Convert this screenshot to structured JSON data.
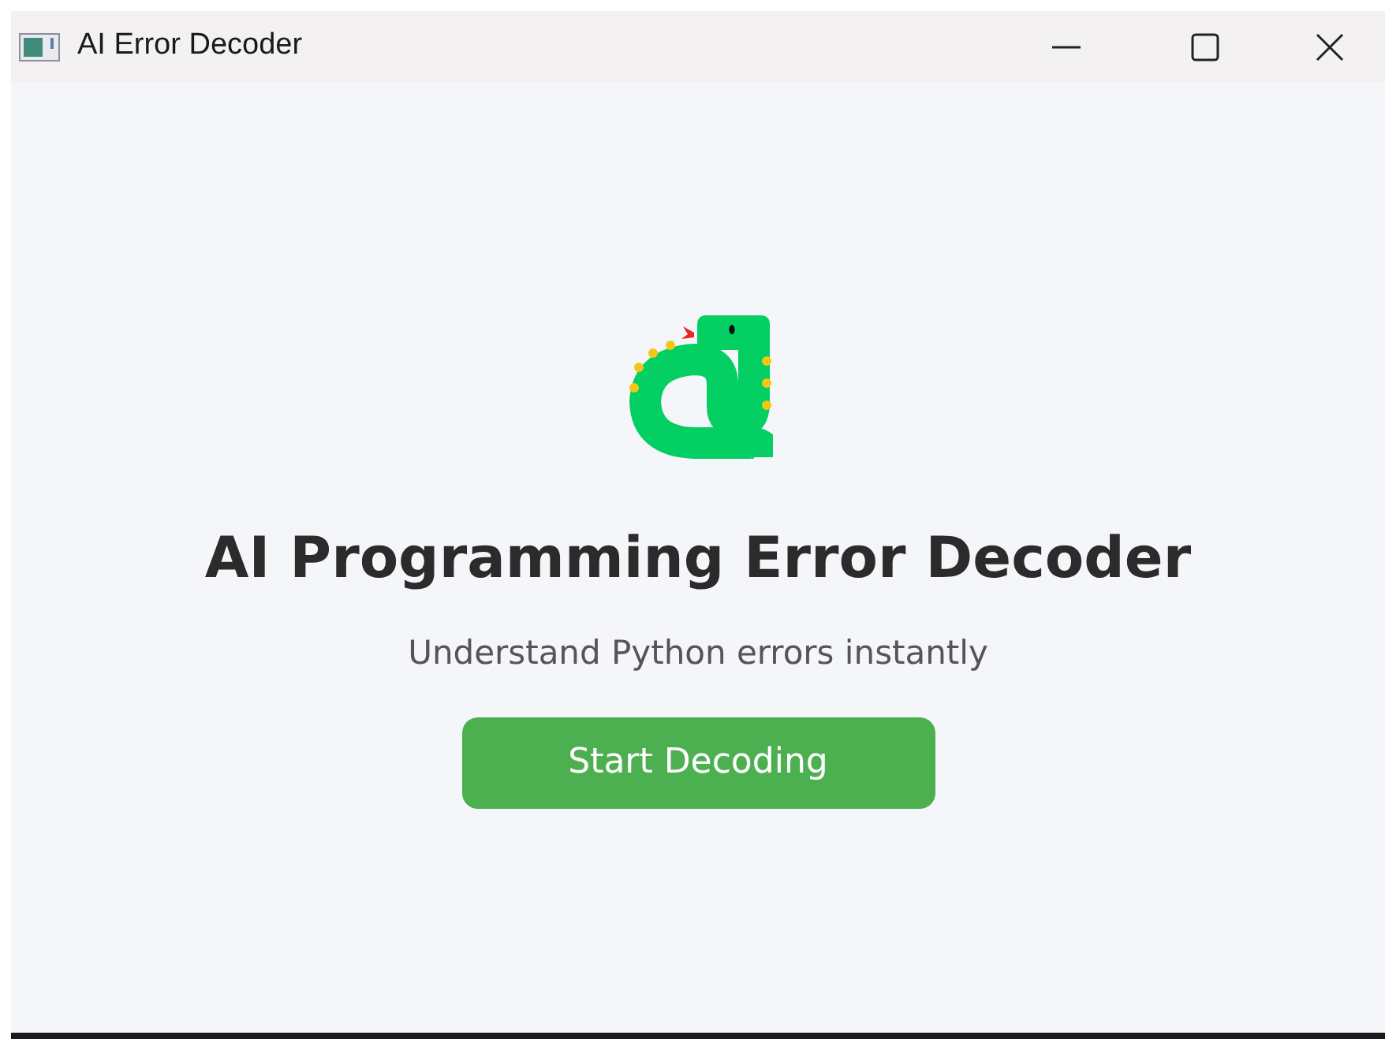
{
  "window": {
    "title": "AI Error Decoder"
  },
  "heading": "AI Programming Error Decoder",
  "subtitle": "Understand Python errors instantly",
  "button": "Start Decoding"
}
